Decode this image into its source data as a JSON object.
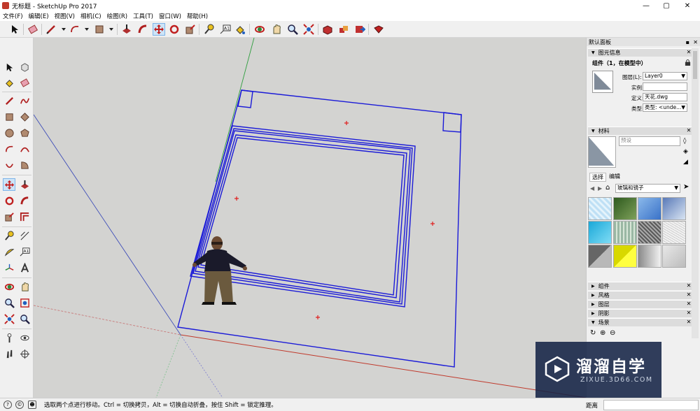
{
  "window": {
    "title": "无标题 - SketchUp Pro 2017"
  },
  "menu": [
    "文件(F)",
    "编辑(E)",
    "视图(V)",
    "相机(C)",
    "绘图(R)",
    "工具(T)",
    "窗口(W)",
    "帮助(H)"
  ],
  "tray": {
    "title": "默认面板",
    "entity_info": {
      "title": "图元信息",
      "heading": "组件（1，在模型中）",
      "layer_label": "图层(L):",
      "layer_value": "Layer0",
      "instance_label": "实例:",
      "instance_value": "",
      "definition_label": "定义:",
      "definition_value": "天花.dwg",
      "type_label": "类型:",
      "type_value": "类型: <unde..."
    },
    "materials": {
      "title": "材料",
      "preset_placeholder": "预设",
      "tab_select": "选择",
      "tab_edit": "编辑",
      "library": "玻璃和镜子"
    },
    "sections": [
      "组件",
      "风格",
      "图层",
      "阴影",
      "场景"
    ]
  },
  "status": {
    "message": "选取两个点进行移动。Ctrl = 切换拷贝，Alt = 切换自动折叠，按住 Shift = 锁定推理。",
    "measurement_label": "距离"
  },
  "watermark": {
    "brand": "溜溜自学",
    "url": "ZIXUE.3D66.COM"
  },
  "colors": {
    "selection": "#1a1ad8",
    "red_axis": "#c0392b",
    "green_axis": "#2e9e3e",
    "blue_axis": "#1f2fb0",
    "viewport": "#d3d3d1"
  }
}
